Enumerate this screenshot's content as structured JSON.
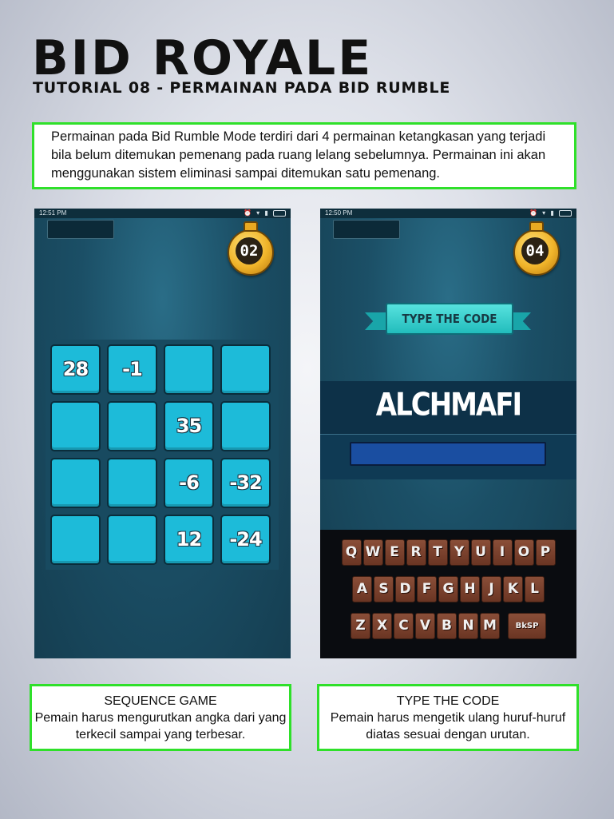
{
  "header": {
    "title": "BID ROYALE",
    "subtitle": "TUTORIAL 08 - PERMAINAN PADA BID RUMBLE"
  },
  "intro": "Permainan pada Bid Rumble Mode terdiri dari 4 permainan ketangkasan yang terjadi bila belum ditemukan pemenang pada ruang lelang sebelumnya. Permainan ini akan menggunakan sistem eliminasi sampai ditemukan satu pemenang.",
  "phone_left": {
    "status_time": "12:51 PM",
    "timer": "02",
    "tiles": [
      "28",
      "-1",
      "",
      "",
      "",
      "",
      "35",
      "",
      "",
      "",
      "-6",
      "-32",
      "",
      "",
      "12",
      "-24"
    ]
  },
  "phone_right": {
    "status_time": "12:50 PM",
    "timer": "04",
    "banner": "TYPE THE CODE",
    "word": "ALCHMAFI",
    "keyboard": {
      "row1": [
        "Q",
        "W",
        "E",
        "R",
        "T",
        "Y",
        "U",
        "I",
        "O",
        "P"
      ],
      "row2": [
        "A",
        "S",
        "D",
        "F",
        "G",
        "H",
        "J",
        "K",
        "L"
      ],
      "row3": [
        "Z",
        "X",
        "C",
        "V",
        "B",
        "N",
        "M"
      ],
      "backspace": "BkSP"
    }
  },
  "captions": {
    "left": {
      "title": "SEQUENCE GAME",
      "text": "Pemain harus mengurutkan angka dari yang terkecil sampai yang terbesar."
    },
    "right": {
      "title": "TYPE THE CODE",
      "text": "Pemain harus mengetik ulang huruf-huruf diatas sesuai dengan urutan."
    }
  },
  "colors": {
    "accent_border": "#2fe02a",
    "tile": "#1dbbd9",
    "game_bg": "#1b4f66",
    "key": "#7a412c"
  }
}
